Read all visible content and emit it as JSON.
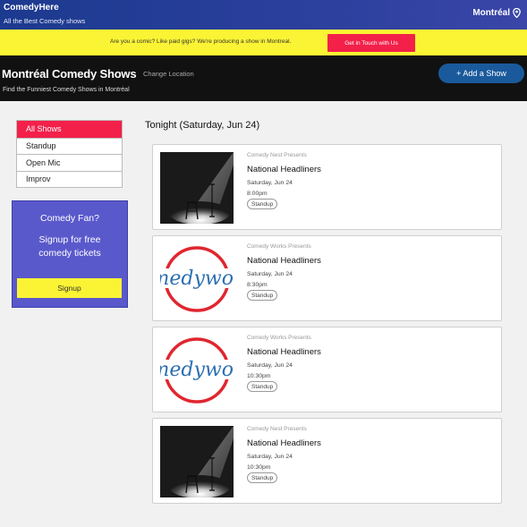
{
  "topbar": {
    "brand": "ComedyHere",
    "tagline": "All the Best Comedy shows",
    "city": "Montréal",
    "city_icon": "map-pin-icon"
  },
  "promo": {
    "text": "Are you a comic? Like paid gigs? We're producing a show in Montreal.",
    "button": "Get in Touch with Us"
  },
  "header": {
    "title": "Montréal Comedy Shows",
    "change_location": "Change Location",
    "subtitle": "Find the Funniest Comedy Shows in Montréal",
    "add_button": "+ Add a Show"
  },
  "filters": [
    {
      "label": "All Shows",
      "active": true
    },
    {
      "label": "Standup",
      "active": false
    },
    {
      "label": "Open Mic",
      "active": false
    },
    {
      "label": "Improv",
      "active": false
    }
  ],
  "fan_box": {
    "title": "Comedy Fan?",
    "text": "Signup for free comedy tickets",
    "button": "Signup"
  },
  "section_title": "Tonight (Saturday, Jun 24)",
  "shows": [
    {
      "presenter": "Comedy Nest Presents",
      "title": "National Headliners",
      "date": "Saturday, Jun 24",
      "time": "8:00pm",
      "tag": "Standup",
      "image": "spotlight-stage"
    },
    {
      "presenter": "Comedy Works Presents",
      "title": "National Headliners",
      "date": "Saturday, Jun 24",
      "time": "8:30pm",
      "tag": "Standup",
      "image": "comedyworks-logo"
    },
    {
      "presenter": "Comedy Works Presents",
      "title": "National Headliners",
      "date": "Saturday, Jun 24",
      "time": "10:30pm",
      "tag": "Standup",
      "image": "comedyworks-logo"
    },
    {
      "presenter": "Comedy Nest Presents",
      "title": "National Headliners",
      "date": "Saturday, Jun 24",
      "time": "10:30pm",
      "tag": "Standup",
      "image": "spotlight-stage"
    }
  ],
  "logo_text": "medywor",
  "colors": {
    "topbar": "#2a3f9c",
    "promo": "#fbf434",
    "accent_red": "#f3204a",
    "header": "#111111",
    "add_button": "#1a5a9c",
    "fan_box": "#5a59cc"
  }
}
